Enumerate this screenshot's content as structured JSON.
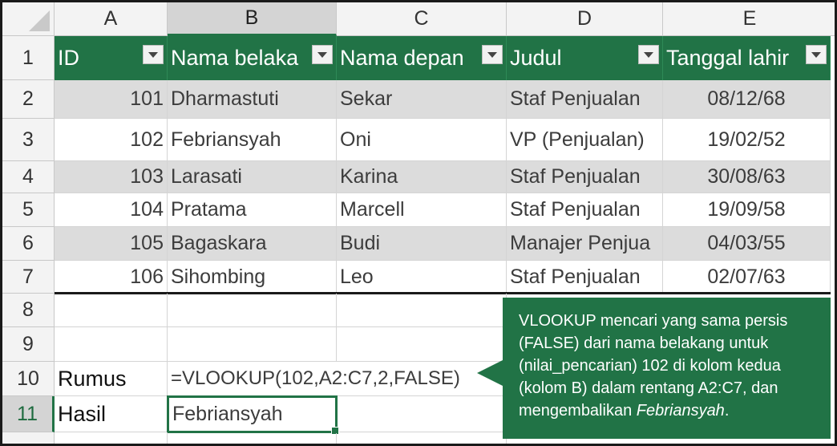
{
  "columns": [
    "A",
    "B",
    "C",
    "D",
    "E"
  ],
  "rows": [
    "1",
    "2",
    "3",
    "4",
    "5",
    "6",
    "7",
    "8",
    "9",
    "10",
    "11"
  ],
  "table_headers": [
    "ID",
    "Nama belaka",
    "Nama depan",
    "Judul",
    "Tanggal lahir"
  ],
  "table_rows": [
    {
      "id": "101",
      "last": "Dharmastuti",
      "first": "Sekar",
      "title": "Staf Penjualan",
      "dob": "08/12/68"
    },
    {
      "id": "102",
      "last": "Febriansyah",
      "first": "Oni",
      "title": "VP (Penjualan)",
      "dob": "19/02/52"
    },
    {
      "id": "103",
      "last": "Larasati",
      "first": "Karina",
      "title": "Staf Penjualan",
      "dob": "30/08/63"
    },
    {
      "id": "104",
      "last": "Pratama",
      "first": "Marcell",
      "title": "Staf Penjualan",
      "dob": "19/09/58"
    },
    {
      "id": "105",
      "last": "Bagaskara",
      "first": "Budi",
      "title": "Manajer Penjua",
      "dob": "04/03/55"
    },
    {
      "id": "106",
      "last": "Sihombing",
      "first": "Leo",
      "title": "Staf Penjualan",
      "dob": "02/07/63"
    }
  ],
  "formula": {
    "label": "Rumus",
    "value": "=VLOOKUP(102,A2:C7,2,FALSE)"
  },
  "result": {
    "label": "Hasil",
    "value": "Febriansyah"
  },
  "callout": {
    "text_before": "VLOOKUP mencari yang sama persis (FALSE) dari nama belakang untuk (nilai_pencarian) 102 di kolom kedua (kolom B) dalam rentang A2:C7, dan mengembalikan ",
    "text_italic": "Febriansyah",
    "text_after": "."
  },
  "colors": {
    "accent": "#217346",
    "band": "#dcdcdc",
    "header_bg": "#f3f3f3"
  },
  "icons": {
    "filter_dropdown": "chevron-down-icon",
    "select_all": "select-all-triangle-icon"
  }
}
